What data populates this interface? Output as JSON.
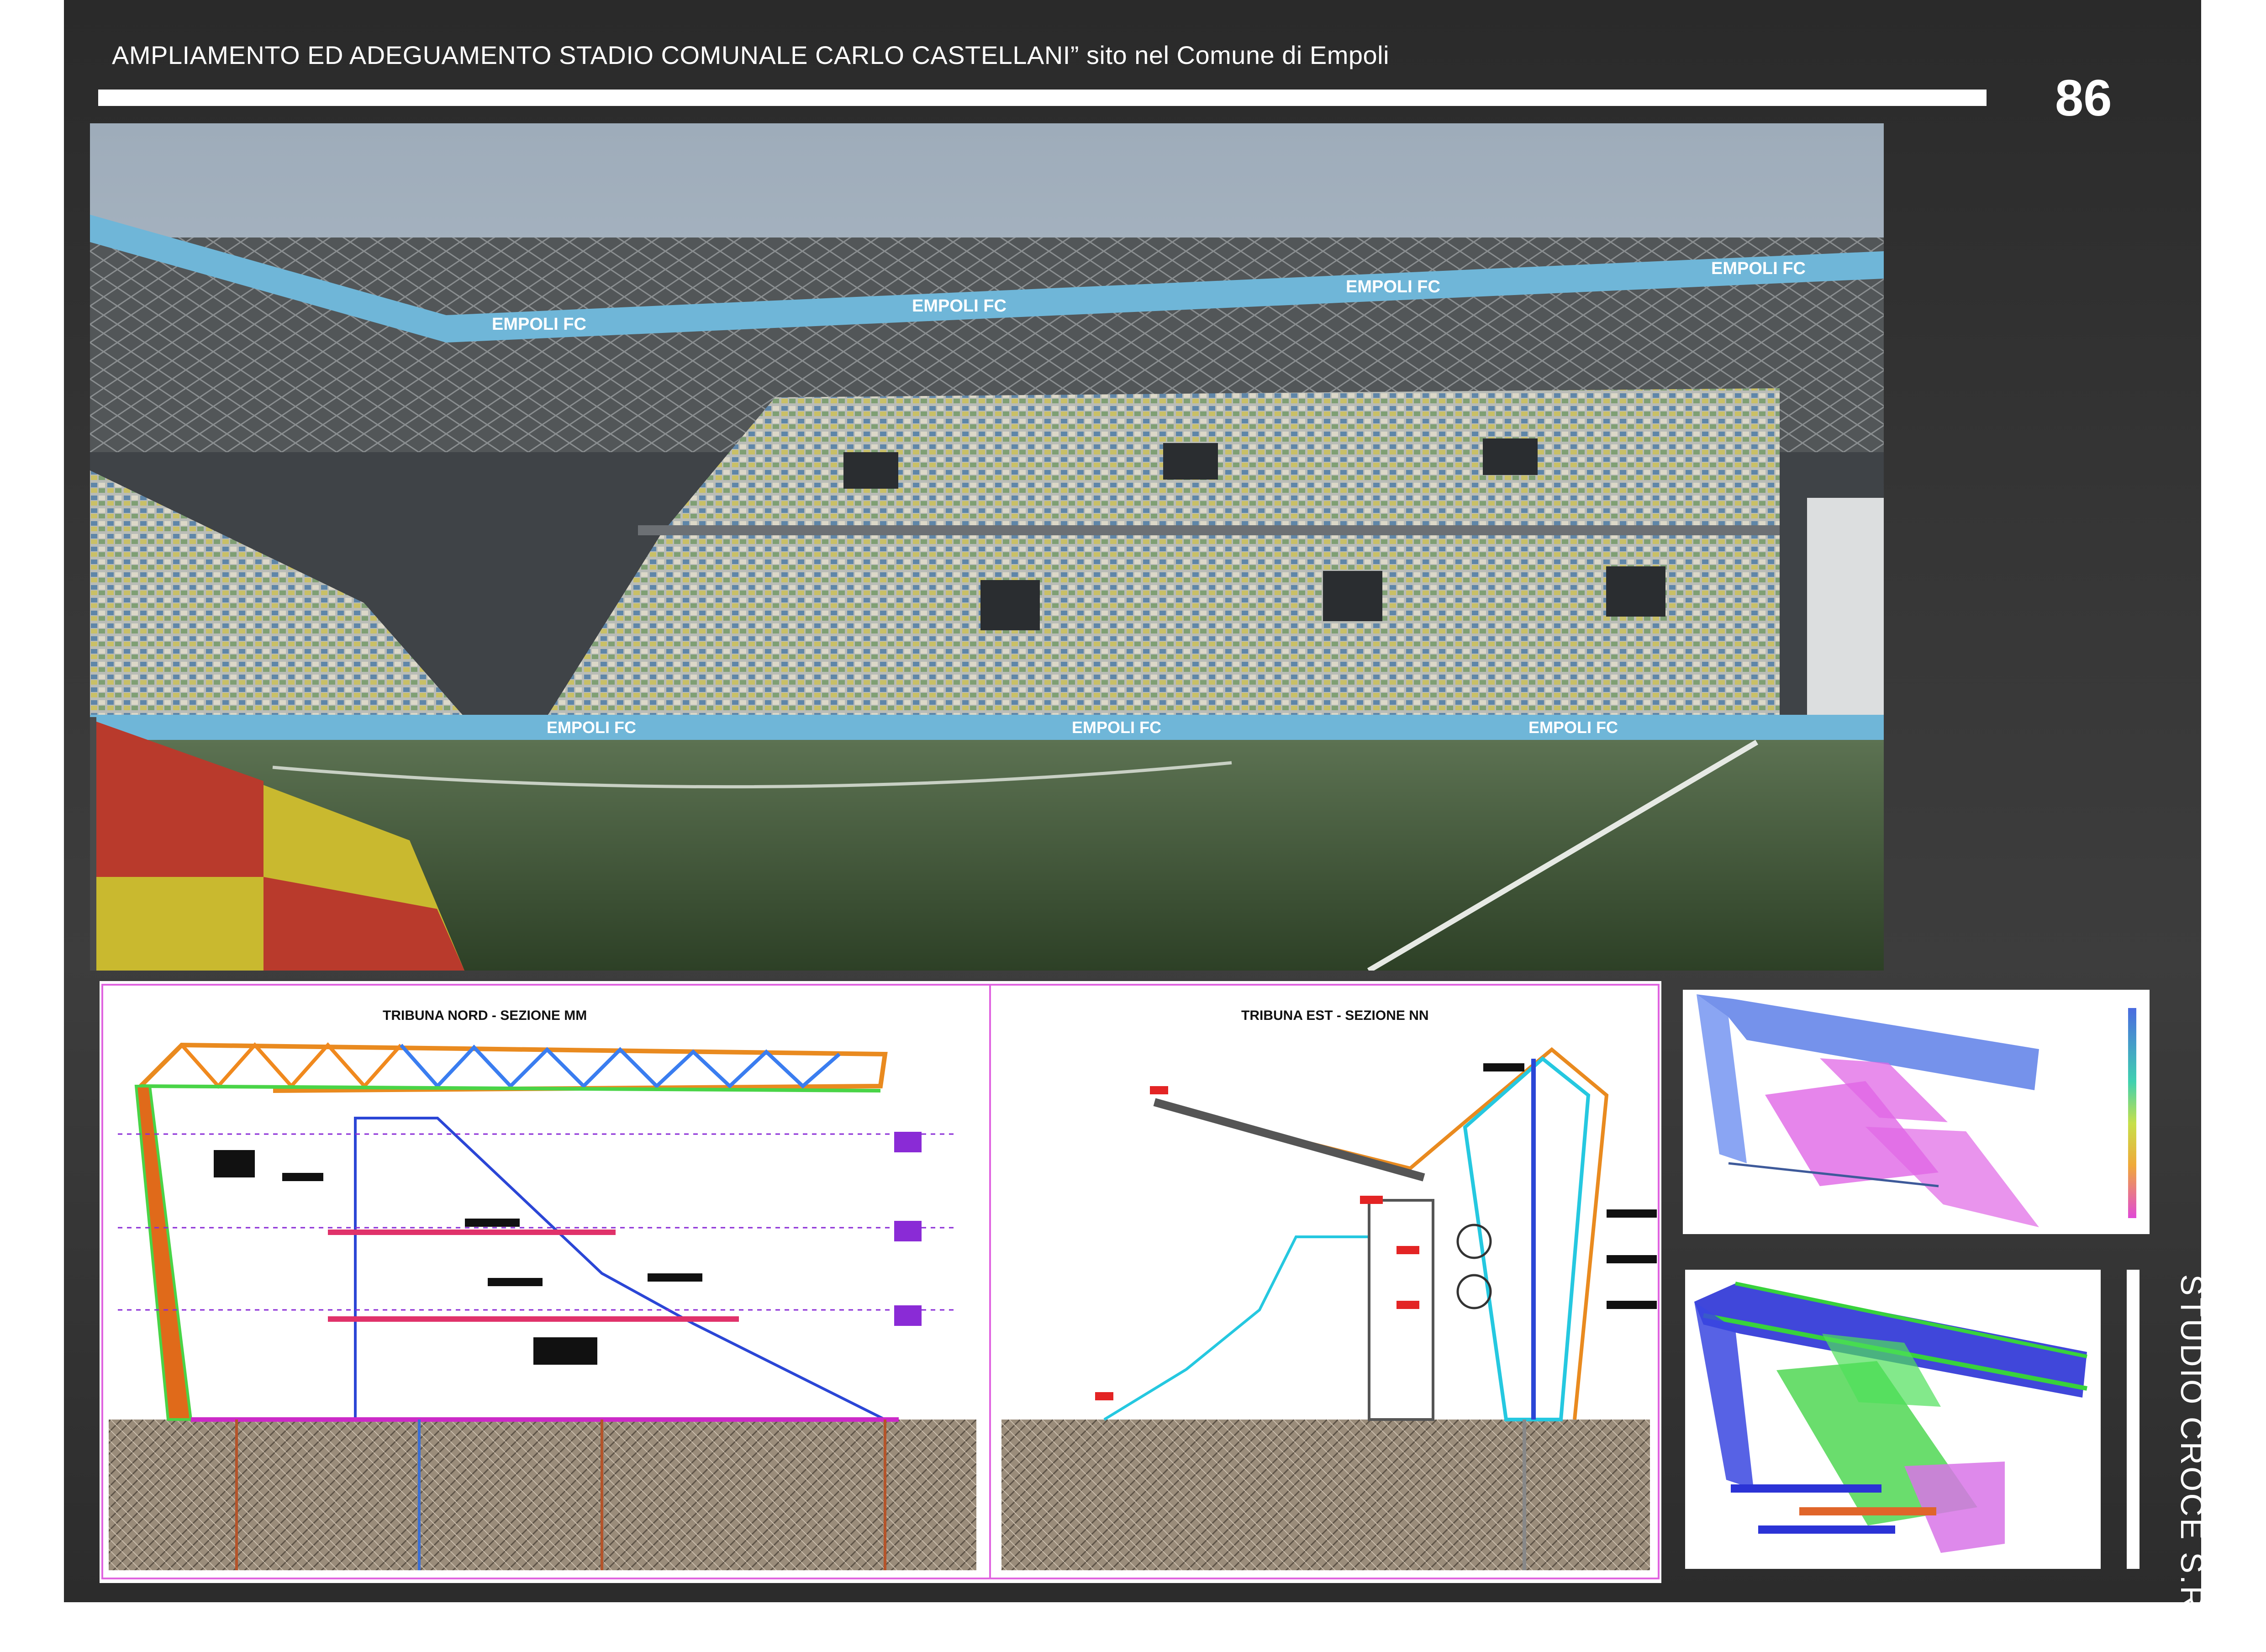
{
  "header": {
    "title": "AMPLIAMENTO ED ADEGUAMENTO STADIO COMUNALE CARLO CASTELLANI” sito nel Comune di Empoli",
    "page_number": "86"
  },
  "render": {
    "banner_text": "EMPOLI FC"
  },
  "sections": {
    "north": {
      "title": "TRIBUNA NORD - SEZIONE MM"
    },
    "east": {
      "title": "TRIBUNA EST - SEZIONE NN"
    }
  },
  "studio_name": "STUDIO CROCE S.R.L.",
  "colors": {
    "sheet": "#363636",
    "rule": "#ffffff",
    "pitch": "#3f5a34",
    "sky": "#a9b6c3",
    "banner": "#6fb6d8",
    "truss_blue": "#2b33d6",
    "truss_green": "#38d23c",
    "slab_magenta": "#e066e6",
    "ground": "#8c8070"
  }
}
